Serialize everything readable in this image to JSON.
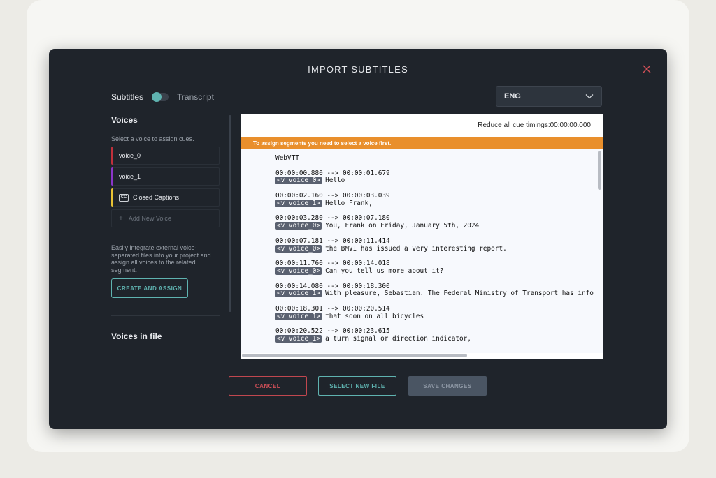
{
  "modal": {
    "title": "IMPORT SUBTITLES",
    "toggle": {
      "left_label": "Subtitles",
      "right_label": "Transcript"
    },
    "language": {
      "selected": "ENG"
    }
  },
  "sidebar": {
    "voices_heading": "Voices",
    "hint": "Select a voice to assign cues.",
    "voices": [
      {
        "label": "voice_0",
        "color": "#c0303b"
      },
      {
        "label": "voice_1",
        "color": "#8b35c9"
      },
      {
        "label": "Closed Captions",
        "color": "#e8c234",
        "icon": "CC"
      }
    ],
    "add_voice_label": "Add New Voice",
    "description": "Easily integrate external voice-separated files into your project and assign all voices to the related segment.",
    "create_button": "CREATE AND ASSIGN",
    "voices_in_file_heading": "Voices in file"
  },
  "panel": {
    "reduce_label": "Reduce all cue timings:00:00:00.000",
    "warning": "To assign segments you need to select a voice first.",
    "header_line": "WebVTT",
    "cues": [
      {
        "timing": "00:00:00.880 --> 00:00:01.679",
        "voice": "<v voice_0>",
        "text": "Hello"
      },
      {
        "timing": "00:00:02.160 --> 00:00:03.039",
        "voice": "<v voice_1>",
        "text": "Hello Frank,"
      },
      {
        "timing": "00:00:03.280 --> 00:00:07.180",
        "voice": "<v voice_0>",
        "text": "You, Frank on Friday, January 5th, 2024"
      },
      {
        "timing": "00:00:07.181 --> 00:00:11.414",
        "voice": "<v voice_0>",
        "text": "the BMVI has issued a very interesting report."
      },
      {
        "timing": "00:00:11.760 --> 00:00:14.018",
        "voice": "<v voice_0>",
        "text": "Can you tell us more about it?"
      },
      {
        "timing": "00:00:14.080 --> 00:00:18.300",
        "voice": "<v voice_1>",
        "text": "With pleasure, Sebastian. The Federal Ministry of Transport has info"
      },
      {
        "timing": "00:00:18.301 --> 00:00:20.514",
        "voice": "<v voice_1>",
        "text": "that soon on all bicycles"
      },
      {
        "timing": "00:00:20.522 --> 00:00:23.615",
        "voice": "<v voice_1>",
        "text": "a turn signal or direction indicator,"
      }
    ]
  },
  "footer": {
    "cancel": "CANCEL",
    "select_new_file": "SELECT NEW FILE",
    "save_changes": "SAVE CHANGES"
  }
}
